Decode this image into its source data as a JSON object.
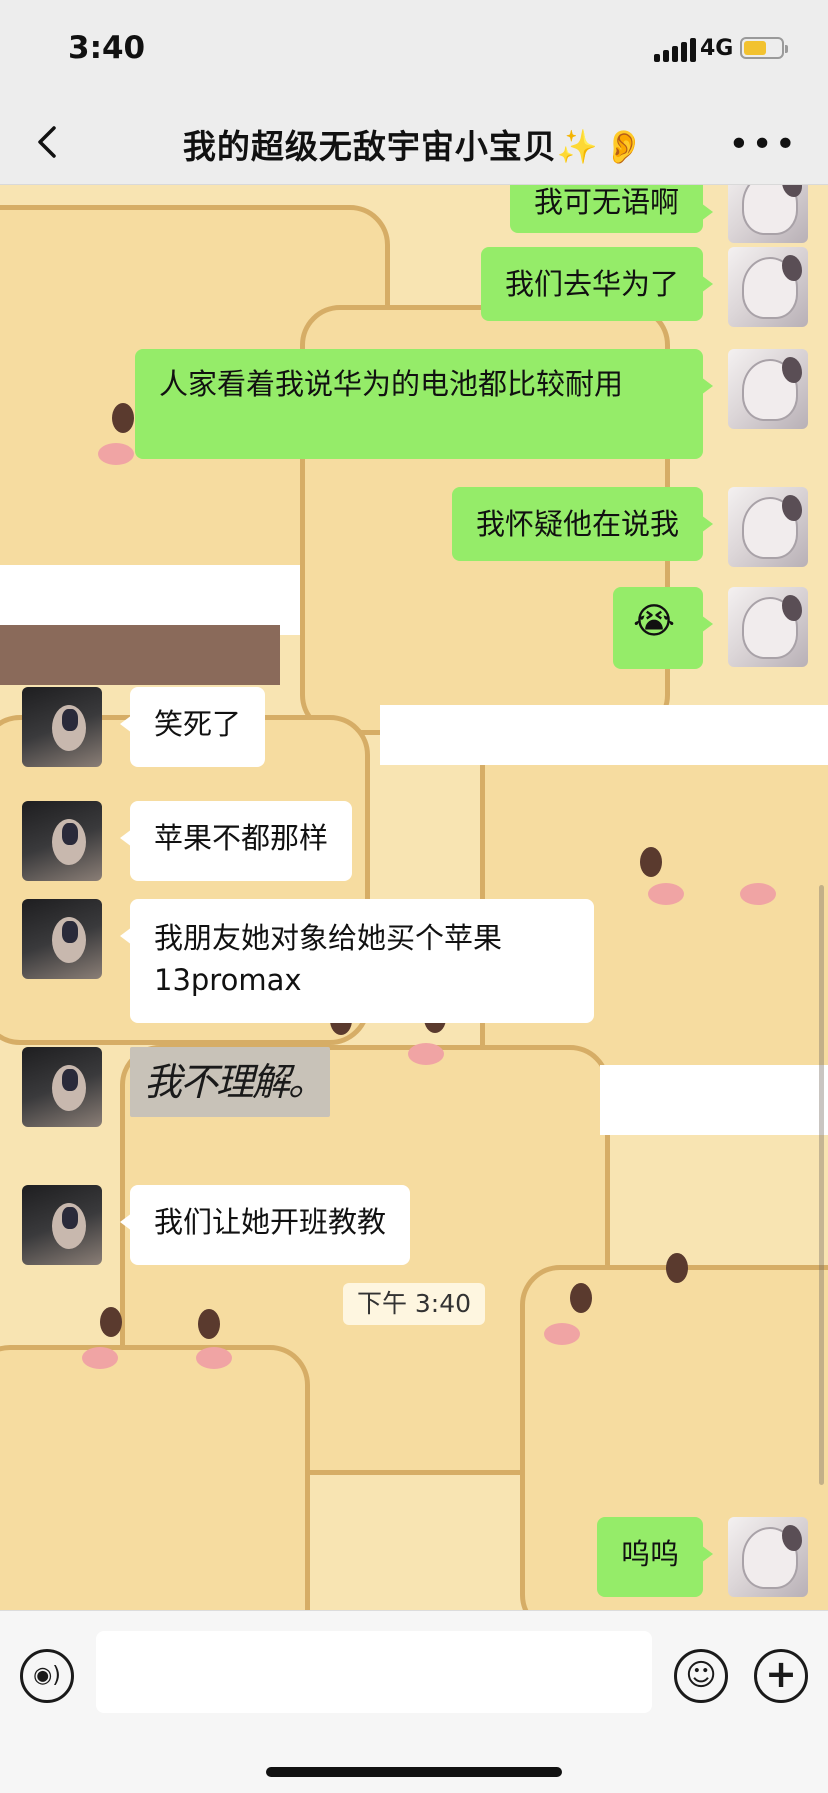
{
  "status": {
    "time": "3:40",
    "network": "4G"
  },
  "nav": {
    "title": "我的超级无敌宇宙小宝贝",
    "sparkle": "✨",
    "ear": "👂"
  },
  "messages": [
    {
      "from": "me",
      "text": "我可无语啊"
    },
    {
      "from": "me",
      "text": "我们去华为了"
    },
    {
      "from": "me",
      "text": "人家看着我说华为的电池都比较耐用"
    },
    {
      "from": "me",
      "text": "我怀疑他在说我"
    },
    {
      "from": "me",
      "text": "😭"
    },
    {
      "from": "other",
      "text": "笑死了"
    },
    {
      "from": "other",
      "text": "苹果不都那样"
    },
    {
      "from": "other",
      "text": "我朋友她对象给她买个苹果13promax"
    },
    {
      "from": "other",
      "sticker_text": "我不理解。"
    },
    {
      "from": "other",
      "text": "我们让她开班教教"
    },
    {
      "timestamp": "下午 3:40"
    },
    {
      "from": "me",
      "text": "呜呜"
    }
  ],
  "colors": {
    "my_bubble": "#95ec69",
    "other_bubble": "#ffffff",
    "nav_bg": "#ededed",
    "wallpaper": "#f8e4b2"
  },
  "icons": [
    "back-chevron-icon",
    "more-icon",
    "voice-icon",
    "emoji-icon",
    "plus-icon"
  ]
}
